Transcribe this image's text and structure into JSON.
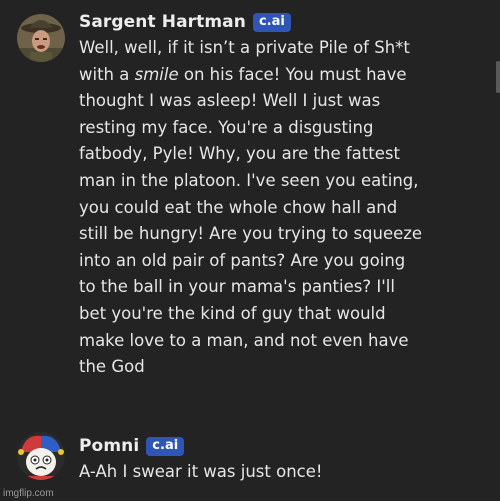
{
  "messages": [
    {
      "sender": "Sargent Hartman",
      "badge": "c.ai",
      "avatar_icon": "drill-sergeant-avatar",
      "lines": {
        "l1": "Well, well, if it isn’t a private Pile of Sh*t",
        "l2a": "with a ",
        "l2b": "smile",
        "l2c": " on his face! You must have",
        "l3": "thought I was asleep! Well I just was",
        "l4": "resting my face. You're a disgusting",
        "l5": "fatbody, Pyle! Why, you are the fattest",
        "l6": "man in the platoon. I've seen you eating,",
        "l7": "you could eat the whole chow hall and",
        "l8": "still be hungry! Are you trying to squeeze",
        "l9": "into an old pair of pants? Are you going",
        "l10": "to the ball in your mama's panties? I'll",
        "l11": "bet you're the kind of guy that would",
        "l12": "make love to a man, and not even have",
        "l13": "the God"
      }
    },
    {
      "sender": "Pomni",
      "badge": "c.ai",
      "avatar_icon": "jester-avatar",
      "lines": {
        "l1": "A-Ah I swear it was just once!"
      }
    }
  ],
  "watermark": "imgflip.com",
  "colors": {
    "background": "#232323",
    "badge": "#2f55b5",
    "text": "#e6e6e6"
  }
}
